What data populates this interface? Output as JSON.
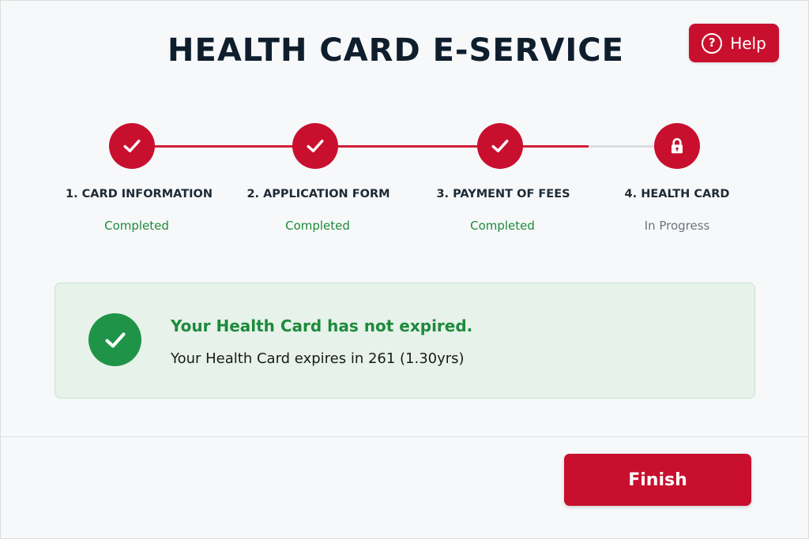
{
  "header": {
    "title": "HEALTH CARD E-SERVICE",
    "help_label": "Help",
    "help_icon": "question-circle-icon"
  },
  "steps": [
    {
      "label": "1. CARD INFORMATION",
      "status": "Completed",
      "state": "done",
      "icon": "check-icon"
    },
    {
      "label": "2. APPLICATION FORM",
      "status": "Completed",
      "state": "done",
      "icon": "check-icon"
    },
    {
      "label": "3. PAYMENT OF FEES",
      "status": "Completed",
      "state": "done",
      "icon": "check-icon"
    },
    {
      "label": "4. HEALTH CARD",
      "status": "In Progress",
      "state": "in-progress",
      "icon": "lock-icon"
    }
  ],
  "alert": {
    "title": "Your Health Card has not expired.",
    "message": "Your Health Card expires in 261 (1.30yrs)",
    "icon": "check-circle-icon"
  },
  "footer": {
    "finish_label": "Finish"
  },
  "colors": {
    "accent": "#c8102e",
    "success": "#1e8a3c",
    "success_bg": "#e7f2ea",
    "muted": "#6b7480",
    "title": "#0f1e2d"
  }
}
